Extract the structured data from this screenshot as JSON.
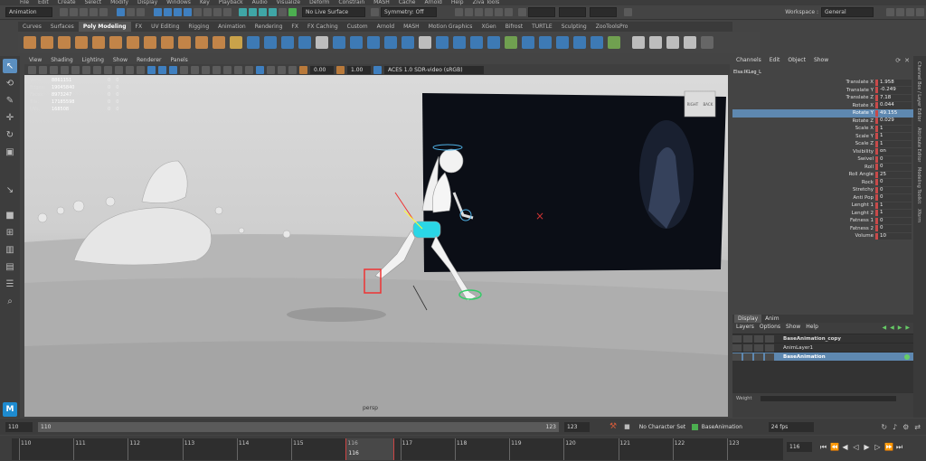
{
  "menus": [
    "File",
    "Edit",
    "Create",
    "Select",
    "Modify",
    "Display",
    "Windows",
    "Key",
    "Playback",
    "Audio",
    "Visualize",
    "Deform",
    "Constrain",
    "MASH",
    "Cache",
    "Arnold",
    "Help",
    "Ziva Tools"
  ],
  "statusline": {
    "menuset": "Animation",
    "live_surface": "No Live Surface",
    "symmetry": "Symmetry: Off",
    "workspace_label": "Workspace :",
    "workspace": "General"
  },
  "shelf_tabs": [
    "Curves",
    "Surfaces",
    "Poly Modeling",
    "FX",
    "UV Editing",
    "Rigging",
    "Animation",
    "Rendering",
    "FX",
    "FX Caching",
    "Custom",
    "Arnold",
    "MASH",
    "Motion Graphics",
    "XGen",
    "Bifrost",
    "TURTLE",
    "Sculpting",
    "ZooToolsPro"
  ],
  "shelf_active": "Poly Modeling",
  "panel_menu": [
    "View",
    "Shading",
    "Lighting",
    "Show",
    "Renderer",
    "Panels"
  ],
  "panel_tools": {
    "exposure": "0.00",
    "gamma": "1.00",
    "colorspace": "ACES 1.0 SDR-video (sRGB)"
  },
  "hud": [
    {
      "label": "Verts:",
      "v1": "8861151",
      "v2": "0",
      "v3": "0"
    },
    {
      "label": "Edges:",
      "v1": "19045840",
      "v2": "0",
      "v3": "0"
    },
    {
      "label": "Faces:",
      "v1": "8973247",
      "v2": "0",
      "v3": "0"
    },
    {
      "label": "Tris:",
      "v1": "17185598",
      "v2": "0",
      "v3": "0"
    },
    {
      "label": "UVs:",
      "v1": "168508",
      "v2": "0",
      "v3": "0"
    }
  ],
  "viewcube": {
    "left": "RIGHT",
    "right": "BACK"
  },
  "camera_label": "persp",
  "channelbox": {
    "menu": [
      "Channels",
      "Edit",
      "Object",
      "Show"
    ],
    "object": "Elsa:IKLeg_L",
    "attributes": [
      {
        "name": "Translate X",
        "value": "1.958"
      },
      {
        "name": "Translate Y",
        "value": "-0.249"
      },
      {
        "name": "Translate Z",
        "value": "7.18"
      },
      {
        "name": "Rotate X",
        "value": "0.044"
      },
      {
        "name": "Rotate Y",
        "value": "49.155",
        "selected": true
      },
      {
        "name": "Rotate Z",
        "value": "0.029"
      },
      {
        "name": "Scale X",
        "value": "1"
      },
      {
        "name": "Scale Y",
        "value": "1"
      },
      {
        "name": "Scale Z",
        "value": "1"
      },
      {
        "name": "Visibility",
        "value": "on"
      },
      {
        "name": "Swivel",
        "value": "0"
      },
      {
        "name": "Roll",
        "value": "0"
      },
      {
        "name": "Roll Angle",
        "value": "25"
      },
      {
        "name": "Rock",
        "value": "0"
      },
      {
        "name": "Stretchy",
        "value": "0"
      },
      {
        "name": "Anti Pop",
        "value": "0"
      },
      {
        "name": "Lenght 1",
        "value": "1"
      },
      {
        "name": "Lenght 2",
        "value": "1"
      },
      {
        "name": "Fatness 1",
        "value": "0"
      },
      {
        "name": "Fatness 2",
        "value": "0"
      },
      {
        "name": "Volume",
        "value": "10"
      }
    ]
  },
  "side_tabs": [
    "Channel Box / Layer Editor",
    "Attribute Editor",
    "Modeling Toolkit",
    "Xform"
  ],
  "layer_editor": {
    "tabs": [
      "Display",
      "Anim"
    ],
    "menu": [
      "Layers",
      "Options",
      "Show",
      "Help"
    ],
    "layers": [
      {
        "name": "BaseAnimation_copy",
        "bold": true
      },
      {
        "name": "AnimLayer1"
      },
      {
        "name": "BaseAnimation",
        "selected": true,
        "bold": true
      }
    ],
    "weight_label": "Weight"
  },
  "range": {
    "start": "110",
    "inner_start": "110",
    "inner_end": "123",
    "end": "123",
    "character_set": "No Character Set",
    "anim_layer": "BaseAnimation",
    "fps": "24 fps"
  },
  "timeline": {
    "ticks": [
      "110",
      "111",
      "112",
      "113",
      "114",
      "115",
      "116",
      "117",
      "118",
      "119",
      "120",
      "121",
      "122",
      "123"
    ],
    "current_frame": "116",
    "current_field": "116"
  },
  "colors": {
    "accent": "#5e88b0",
    "keyframe": "#c84a4a"
  }
}
